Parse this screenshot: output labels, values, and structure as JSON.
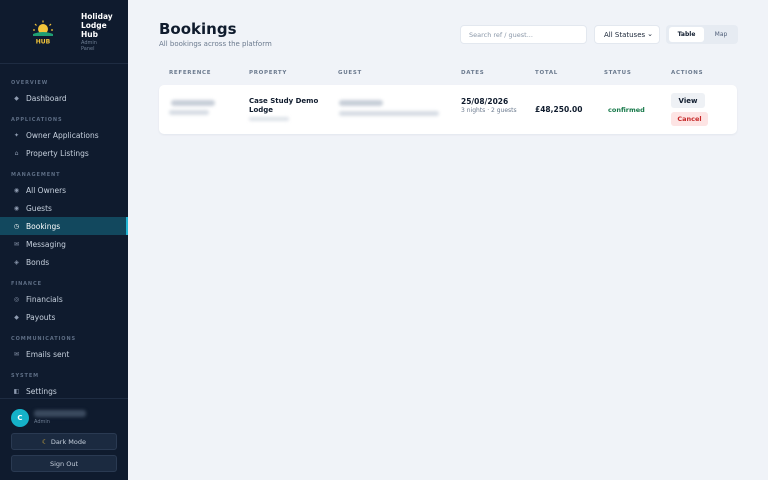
{
  "brand": {
    "title": "Holiday Lodge Hub",
    "subtitle": "Admin Panel",
    "logo_text": "HUB"
  },
  "sidebar": {
    "sections": [
      {
        "label": "OVERVIEW"
      },
      {
        "label": "APPLICATIONS"
      },
      {
        "label": "MANAGEMENT"
      },
      {
        "label": "FINANCE"
      },
      {
        "label": "COMMUNICATIONS"
      },
      {
        "label": "SYSTEM"
      }
    ],
    "items": [
      {
        "label": "Dashboard",
        "icon": "diamond-icon"
      },
      {
        "label": "Owner Applications",
        "icon": "sparkle-icon"
      },
      {
        "label": "Property Listings",
        "icon": "home-icon"
      },
      {
        "label": "All Owners",
        "icon": "circle-icon"
      },
      {
        "label": "Guests",
        "icon": "circle-icon"
      },
      {
        "label": "Bookings",
        "icon": "clock-icon",
        "active": true
      },
      {
        "label": "Messaging",
        "icon": "mail-icon"
      },
      {
        "label": "Bonds",
        "icon": "diamond-icon"
      },
      {
        "label": "Financials",
        "icon": "target-icon"
      },
      {
        "label": "Payouts",
        "icon": "diamond-icon"
      },
      {
        "label": "Emails sent",
        "icon": "mail-icon"
      },
      {
        "label": "Settings",
        "icon": "panel-icon"
      }
    ]
  },
  "user": {
    "initial": "C",
    "role": "Admin"
  },
  "buttons": {
    "dark_mode": "Dark Mode",
    "sign_out": "Sign Out"
  },
  "header": {
    "title": "Bookings",
    "subtitle": "All bookings across the platform"
  },
  "filters": {
    "search_placeholder": "Search ref / guest...",
    "status_value": "All Statuses",
    "view_table": "Table",
    "view_map": "Map"
  },
  "table": {
    "columns": [
      "REFERENCE",
      "PROPERTY",
      "GUEST",
      "DATES",
      "TOTAL",
      "STATUS",
      "ACTIONS"
    ],
    "rows": [
      {
        "property": "Case Study Demo Lodge",
        "date": "25/08/2026",
        "date_details": "3 nights · 2 guests",
        "total": "£48,250.00",
        "status": "confirmed",
        "view": "View",
        "cancel": "Cancel"
      }
    ]
  },
  "colors": {
    "sidebar_bg": "#0f1b2e",
    "accent": "#22b4d3",
    "active_bg": "#12485e",
    "status_confirmed": "#17794a",
    "danger": "#c62828"
  }
}
